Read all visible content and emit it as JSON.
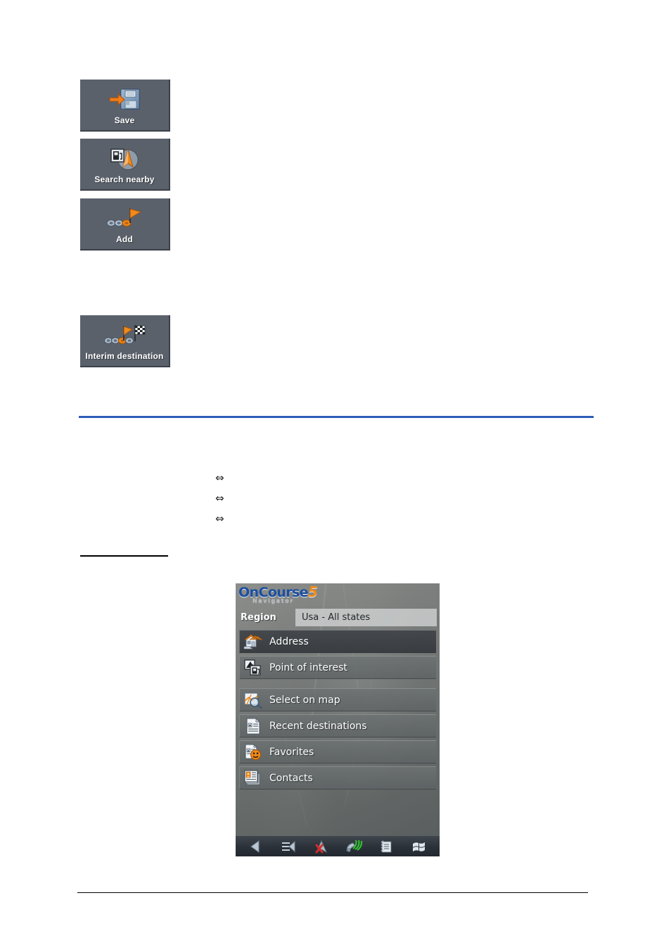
{
  "doc_buttons": [
    {
      "label": "Save",
      "icon": "save-floppy-icon"
    },
    {
      "label": "Search nearby",
      "icon": "search-nearby-poi-icon"
    },
    {
      "label": "Add",
      "icon": "add-route-flag-icon"
    },
    {
      "label": "Interim destination",
      "icon": "interim-destination-checkered-flag-icon"
    }
  ],
  "bullets": [
    {
      "glyph": "⇔"
    },
    {
      "glyph": "⇔"
    },
    {
      "glyph": "⇔"
    }
  ],
  "device": {
    "logo": {
      "brand": "OnCourse",
      "version": "5",
      "subtitle": "Navigator"
    },
    "region": {
      "label": "Region",
      "value": "Usa - All states"
    },
    "menu_items": [
      {
        "label": "Address",
        "icon": "house-address-icon",
        "selected": true
      },
      {
        "label": "Point of interest",
        "icon": "poi-icon",
        "selected": false
      },
      {
        "label": "Select on map",
        "icon": "map-magnifier-icon",
        "selected": false
      },
      {
        "label": "Recent destinations",
        "icon": "recent-list-icon",
        "selected": false
      },
      {
        "label": "Favorites",
        "icon": "favorites-smiley-icon",
        "selected": false
      },
      {
        "label": "Contacts",
        "icon": "contacts-card-icon",
        "selected": false
      }
    ],
    "taskbar_icons": [
      {
        "name": "back-arrow-icon"
      },
      {
        "name": "menu-list-icon"
      },
      {
        "name": "gps-no-signal-icon"
      },
      {
        "name": "satellite-signal-icon"
      },
      {
        "name": "notepad-icon"
      },
      {
        "name": "windows-start-icon"
      }
    ]
  },
  "colors": {
    "rule_blue": "#2e5cb8",
    "rule_black": "#000000",
    "button_face": "#5b616b",
    "accent_orange": "#ef8a1b",
    "brand_blue": "#1c4fa0"
  }
}
